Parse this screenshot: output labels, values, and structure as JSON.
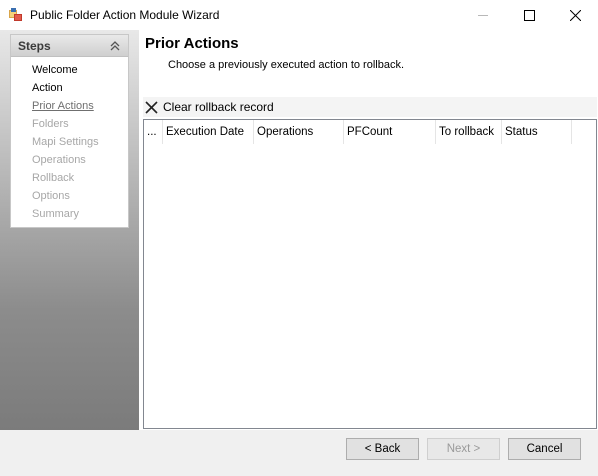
{
  "window": {
    "title": "Public Folder Action Module Wizard",
    "controls": {
      "minimize": "minimize-icon",
      "maximize": "maximize-icon",
      "close": "close-icon"
    }
  },
  "sidebar": {
    "header": "Steps",
    "steps": [
      {
        "label": "Welcome",
        "state": "done"
      },
      {
        "label": "Action",
        "state": "done"
      },
      {
        "label": "Prior Actions",
        "state": "current"
      },
      {
        "label": "Folders",
        "state": "pending"
      },
      {
        "label": "Mapi Settings",
        "state": "pending"
      },
      {
        "label": "Operations",
        "state": "pending"
      },
      {
        "label": "Rollback",
        "state": "pending"
      },
      {
        "label": "Options",
        "state": "pending"
      },
      {
        "label": "Summary",
        "state": "pending"
      }
    ]
  },
  "main": {
    "title": "Prior Actions",
    "subtitle": "Choose a previously executed action to rollback.",
    "toolbar": {
      "clear_label": "Clear rollback record",
      "clear_icon": "x-icon"
    },
    "grid": {
      "columns": [
        "...",
        "Execution Date",
        "Operations",
        "PFCount",
        "To rollback",
        "Status"
      ],
      "rows": []
    }
  },
  "footer": {
    "back_label": "< Back",
    "next_label": "Next >",
    "cancel_label": "Cancel"
  },
  "colors": {
    "sidebar_gradient_top": "#e8e8e8",
    "sidebar_gradient_bottom": "#7b7b7b",
    "disabled_text": "#a7a7a7",
    "footer_bg": "#f0f0f0"
  }
}
